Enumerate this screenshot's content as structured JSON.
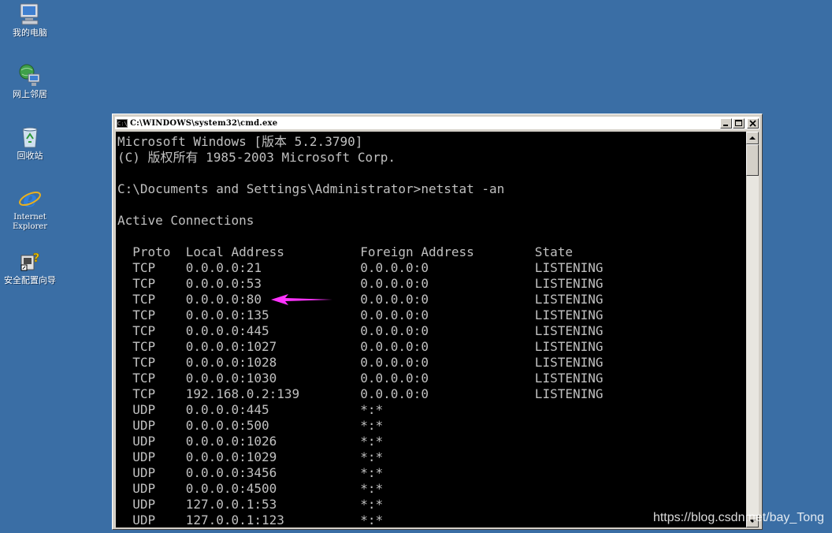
{
  "desktop": {
    "icons": [
      {
        "label": "我的电脑",
        "icon": "computer-icon"
      },
      {
        "label": "网上邻居",
        "icon": "network-icon"
      },
      {
        "label": "回收站",
        "icon": "recycle-bin-icon"
      },
      {
        "label": "Internet\nExplorer",
        "icon": "internet-explorer-icon"
      },
      {
        "label": "安全配置向导",
        "icon": "security-wizard-icon"
      }
    ]
  },
  "window": {
    "title": "C:\\WINDOWS\\system32\\cmd.exe",
    "controls": {
      "minimize": "_",
      "maximize": "□",
      "close": "×"
    }
  },
  "console": {
    "lines": [
      "Microsoft Windows [版本 5.2.3790]",
      "(C) 版权所有 1985-2003 Microsoft Corp.",
      "",
      "C:\\Documents and Settings\\Administrator>netstat -an",
      "",
      "Active Connections",
      "",
      "  Proto  Local Address          Foreign Address        State",
      "  TCP    0.0.0.0:21             0.0.0.0:0              LISTENING",
      "  TCP    0.0.0.0:53             0.0.0.0:0              LISTENING",
      "  TCP    0.0.0.0:80             0.0.0.0:0              LISTENING",
      "  TCP    0.0.0.0:135            0.0.0.0:0              LISTENING",
      "  TCP    0.0.0.0:445            0.0.0.0:0              LISTENING",
      "  TCP    0.0.0.0:1027           0.0.0.0:0              LISTENING",
      "  TCP    0.0.0.0:1028           0.0.0.0:0              LISTENING",
      "  TCP    0.0.0.0:1030           0.0.0.0:0              LISTENING",
      "  TCP    192.168.0.2:139        0.0.0.0:0              LISTENING",
      "  UDP    0.0.0.0:445            *:*",
      "  UDP    0.0.0.0:500            *:*",
      "  UDP    0.0.0.0:1026           *:*",
      "  UDP    0.0.0.0:1029           *:*",
      "  UDP    0.0.0.0:3456           *:*",
      "  UDP    0.0.0.0:4500           *:*",
      "  UDP    127.0.0.1:53           *:*",
      "  UDP    127.0.0.1:123          *:*"
    ]
  },
  "annotation": {
    "arrow_color": "#ff33ff"
  },
  "watermark": "https://blog.csdn.net/bay_Tong",
  "colors": {
    "desktop": "#3a6ea5",
    "console_bg": "#000000",
    "console_fg": "#c0c0c0"
  }
}
